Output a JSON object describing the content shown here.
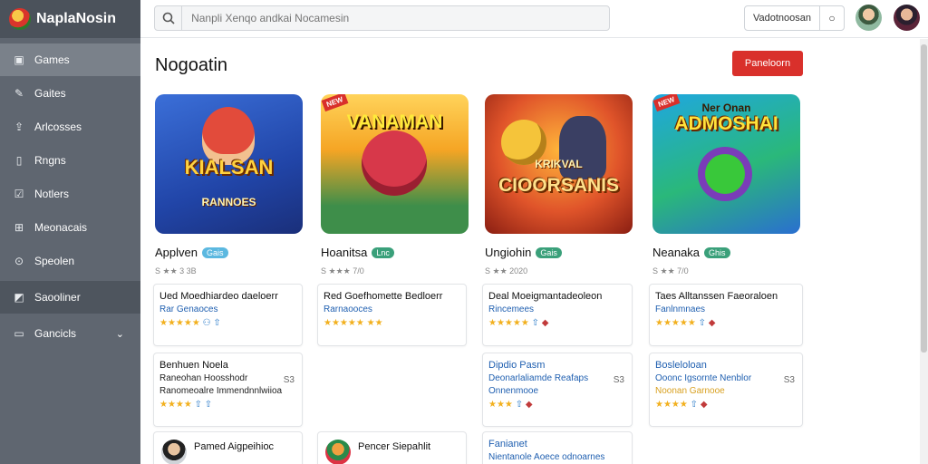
{
  "brand": {
    "name": "NaplaNosin"
  },
  "sidebar": {
    "items": [
      {
        "label": "Games",
        "icon": "image-icon"
      },
      {
        "label": "Gaites",
        "icon": "pencil-icon"
      },
      {
        "label": "Arlcosses",
        "icon": "upload-icon"
      },
      {
        "label": "Rngns",
        "icon": "book-icon"
      },
      {
        "label": "Notlers",
        "icon": "check-square-icon"
      },
      {
        "label": "Meonacais",
        "icon": "grid-icon"
      },
      {
        "label": "Speolen",
        "icon": "gamepad-icon"
      },
      {
        "label": "Saooliner",
        "icon": "shield-icon"
      },
      {
        "label": "Gancicls",
        "icon": "folder-icon"
      }
    ]
  },
  "search": {
    "placeholder": "Nanpli Xenqo andkai Nocamesin"
  },
  "topbar": {
    "button_label": "Vadotnoosan",
    "button_icon": "○"
  },
  "main": {
    "title": "Nogoatin",
    "primary_button": "Paneloorn"
  },
  "games": [
    {
      "thumb_title": "KIALSAN",
      "thumb_sub": "RANNOES",
      "name": "Applven",
      "tag": "Gais",
      "tag_color": "#5bb8e0",
      "rating": "S ★★ 3 3B"
    },
    {
      "thumb_title": "VANAMAN",
      "thumb_sub": "",
      "name": "Hoanitsa",
      "tag": "Lnc",
      "tag_color": "#3aa07a",
      "rating": "S ★★★ 7/0"
    },
    {
      "thumb_title": "CIOORSANIS",
      "thumb_sub": "KRIKVAL",
      "name": "Ungiohin",
      "tag": "Gais",
      "tag_color": "#3aa07a",
      "rating": "S ★★ 2020",
      "badge": ""
    },
    {
      "thumb_title": "ADMOSHAI",
      "thumb_sub": "Ner Onan",
      "name": "Neanaka",
      "tag": "Ghis",
      "tag_color": "#3aa07a",
      "rating": "S ★★ 7/0"
    }
  ],
  "reviews_row1": [
    {
      "title": "Ued Moedhiardeo daeloerr",
      "sub": "Rar Genaoces",
      "stars": "★★★★★"
    },
    {
      "title": "Red Goefhomette Bedloerr",
      "sub": "Rarnaooces",
      "stars": "★★★★★"
    },
    {
      "title": "Deal Moeigmantadeoleon",
      "sub": "Rincemees",
      "stars": "★★★★★"
    },
    {
      "title": "Taes Alltanssen Faeoraloen",
      "sub": "Fanlnmnaes",
      "stars": "★★★★★"
    }
  ],
  "reviews_row2": [
    {
      "title": "Benhuen Noela",
      "sub": "Raneohan Hoosshodr",
      "stars": "★★★★",
      "side": "S3"
    },
    {
      "title": "Dipdio Pasm",
      "sub": "Deonarlaliamde Reafaps",
      "extra": "Onnenmooe",
      "stars": "★★★",
      "side": "S3"
    },
    {
      "title": "Bosleloloan",
      "sub": "Ooonc Igsornte Nenblor",
      "extra": "Noonan Garnooe",
      "stars": "★★★★",
      "side": "S3"
    }
  ],
  "reviews_row3": [
    {
      "title": "Pamed Aigpeihioc"
    },
    {
      "title": "Pencer Siepahlit"
    },
    {
      "title": "Fanianet",
      "sub": "Nientanole Aoece odnoarnes"
    }
  ]
}
